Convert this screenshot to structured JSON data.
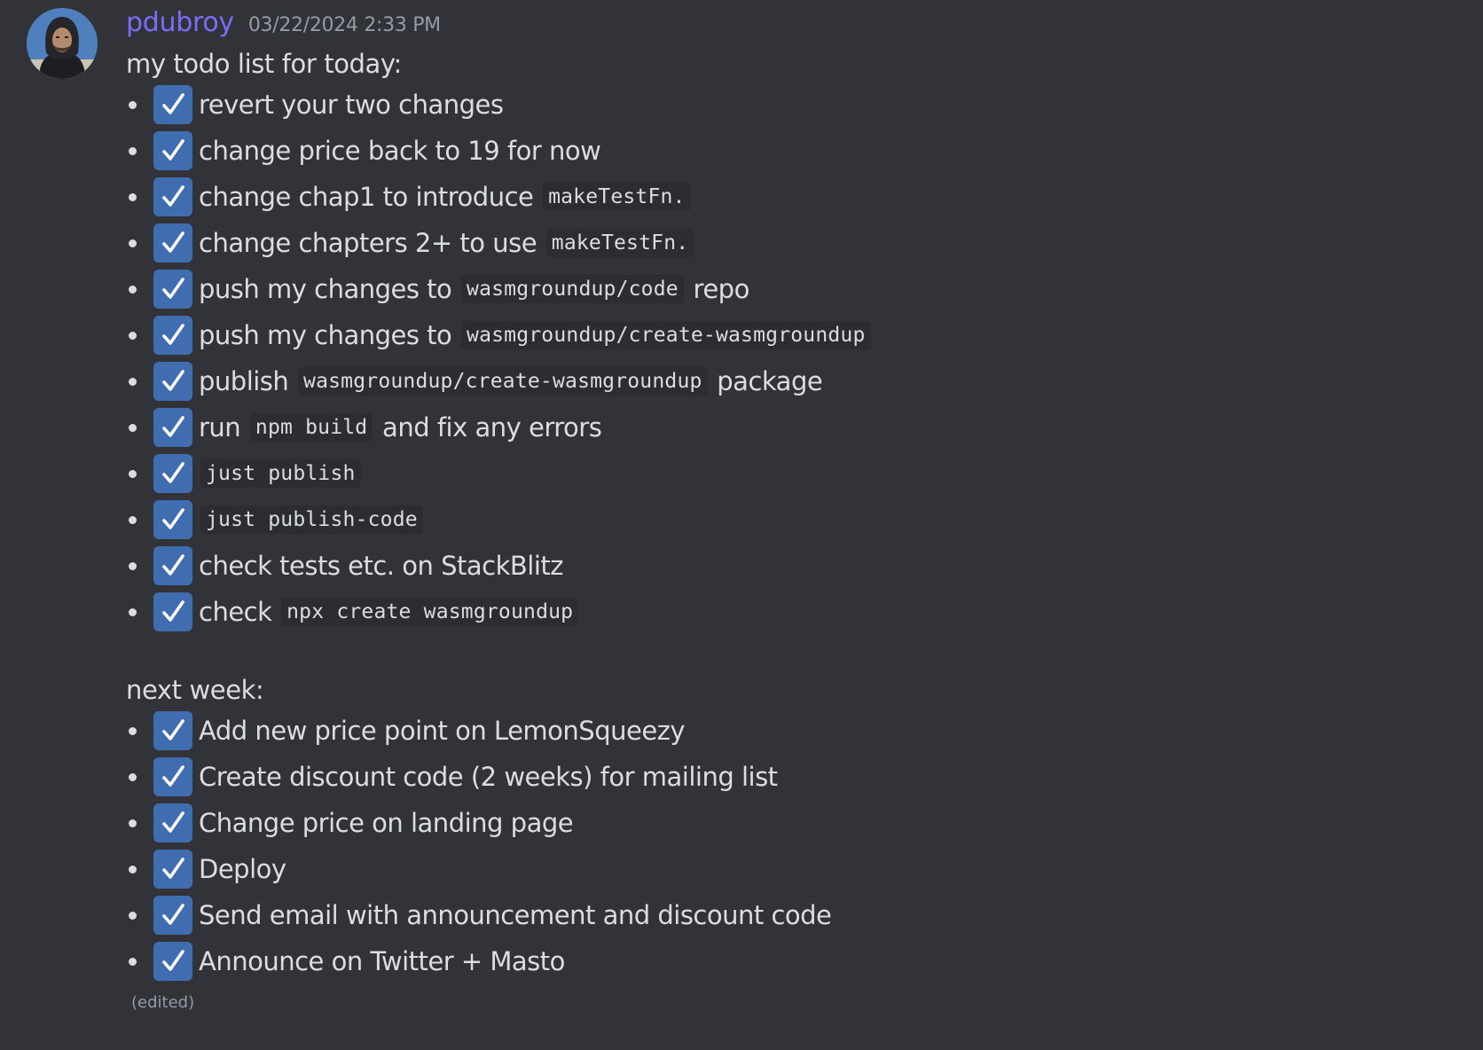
{
  "message": {
    "username": "pdubroy",
    "timestamp": "03/22/2024 2:33 PM",
    "avatar_icon": "user-avatar-photo",
    "edited_label": "(edited)",
    "username_color": "#7b6ef6",
    "checkbox_color": "#3f6db0",
    "background_color": "#313338"
  },
  "today": {
    "heading": "my todo list for today:",
    "tasks": [
      {
        "checked": true,
        "parts": [
          {
            "type": "text",
            "value": "revert your two changes"
          }
        ]
      },
      {
        "checked": true,
        "parts": [
          {
            "type": "text",
            "value": "change price back to 19 for now"
          }
        ]
      },
      {
        "checked": true,
        "parts": [
          {
            "type": "text",
            "value": "change chap1 to introduce "
          },
          {
            "type": "code",
            "value": "makeTestFn."
          }
        ]
      },
      {
        "checked": true,
        "parts": [
          {
            "type": "text",
            "value": "change chapters 2+ to use "
          },
          {
            "type": "code",
            "value": "makeTestFn."
          }
        ]
      },
      {
        "checked": true,
        "parts": [
          {
            "type": "text",
            "value": "push my changes to "
          },
          {
            "type": "code",
            "value": "wasmgroundup/code"
          },
          {
            "type": "text",
            "value": " repo"
          }
        ]
      },
      {
        "checked": true,
        "parts": [
          {
            "type": "text",
            "value": "push my changes to "
          },
          {
            "type": "code",
            "value": "wasmgroundup/create-wasmgroundup"
          }
        ]
      },
      {
        "checked": true,
        "parts": [
          {
            "type": "text",
            "value": "publish "
          },
          {
            "type": "code",
            "value": "wasmgroundup/create-wasmgroundup"
          },
          {
            "type": "text",
            "value": " package"
          }
        ]
      },
      {
        "checked": true,
        "parts": [
          {
            "type": "text",
            "value": "run "
          },
          {
            "type": "code",
            "value": "npm build"
          },
          {
            "type": "text",
            "value": " and fix any errors"
          }
        ]
      },
      {
        "checked": true,
        "parts": [
          {
            "type": "code",
            "value": "just publish"
          }
        ]
      },
      {
        "checked": true,
        "parts": [
          {
            "type": "code",
            "value": "just publish-code"
          }
        ]
      },
      {
        "checked": true,
        "parts": [
          {
            "type": "text",
            "value": "check tests etc. on StackBlitz"
          }
        ]
      },
      {
        "checked": true,
        "parts": [
          {
            "type": "text",
            "value": "check "
          },
          {
            "type": "code",
            "value": "npx create wasmgroundup"
          }
        ]
      }
    ]
  },
  "next_week": {
    "heading": "next week:",
    "tasks": [
      {
        "checked": true,
        "parts": [
          {
            "type": "text",
            "value": "Add new price point on LemonSqueezy"
          }
        ]
      },
      {
        "checked": true,
        "parts": [
          {
            "type": "text",
            "value": "Create discount code (2 weeks) for mailing list"
          }
        ]
      },
      {
        "checked": true,
        "parts": [
          {
            "type": "text",
            "value": "Change price on landing page"
          }
        ]
      },
      {
        "checked": true,
        "parts": [
          {
            "type": "text",
            "value": "Deploy"
          }
        ]
      },
      {
        "checked": true,
        "parts": [
          {
            "type": "text",
            "value": "Send email with announcement and discount code"
          }
        ]
      },
      {
        "checked": true,
        "parts": [
          {
            "type": "text",
            "value": "Announce on Twitter + Masto"
          }
        ]
      }
    ]
  }
}
